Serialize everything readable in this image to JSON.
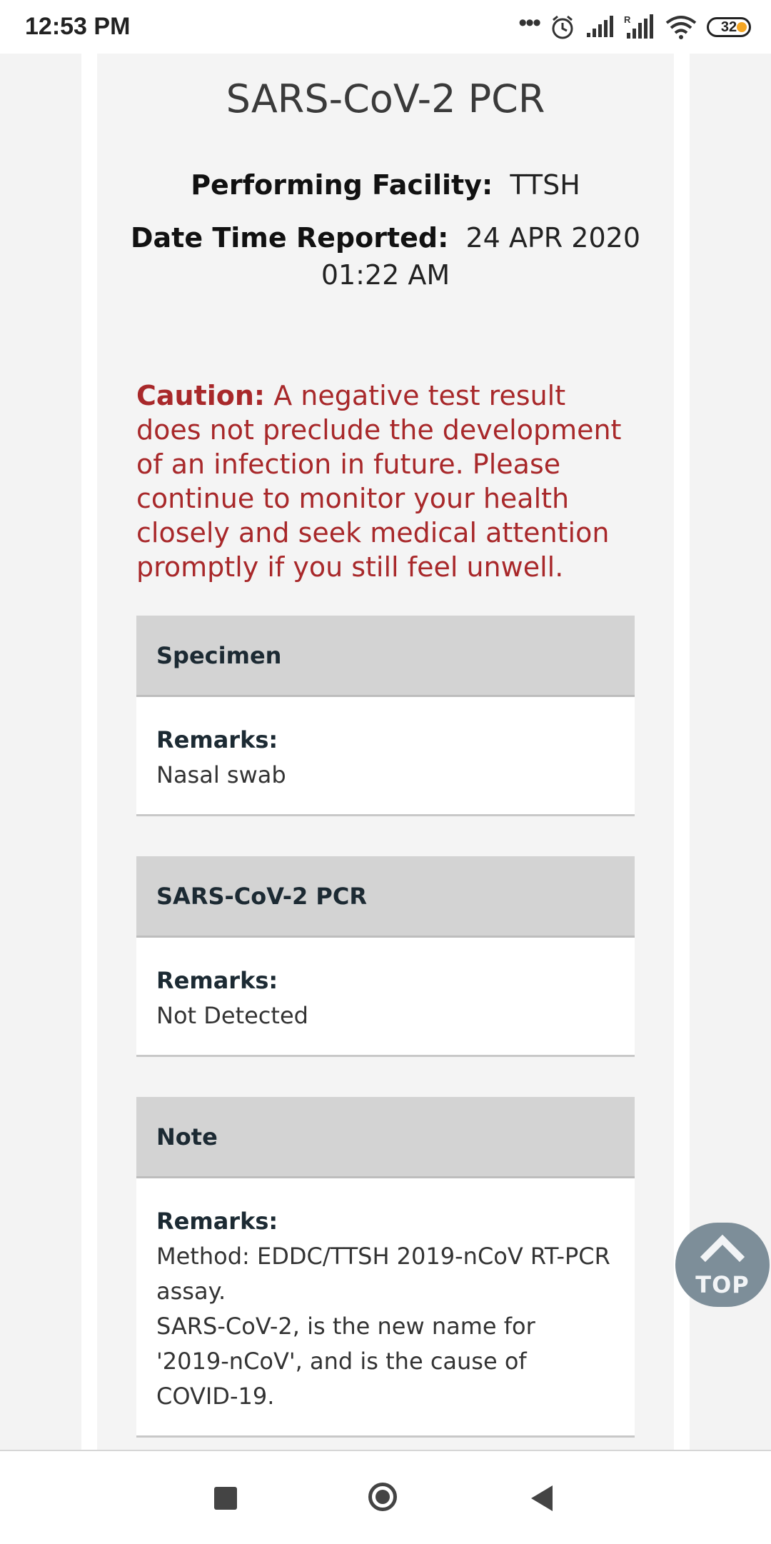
{
  "status_bar": {
    "time": "12:53 PM",
    "battery": "32"
  },
  "report": {
    "title": "SARS-CoV-2 PCR",
    "facility_label": "Performing Facility:",
    "facility_value": "TTSH",
    "reported_label": "Date Time Reported:",
    "reported_date": "24 APR 2020",
    "reported_time": "01:22 AM",
    "caution_label": "Caution:",
    "caution_text": "A negative test result does not preclude the development of an infection in future. Please continue to monitor your health closely and seek medical attention promptly if you still feel unwell."
  },
  "sections": [
    {
      "header": "Specimen",
      "remarks_label": "Remarks:",
      "remarks": "Nasal swab"
    },
    {
      "header": "SARS-CoV-2 PCR",
      "remarks_label": "Remarks:",
      "remarks": "Not Detected"
    },
    {
      "header": "Note",
      "remarks_label": "Remarks:",
      "remarks": "Method: EDDC/TTSH 2019-nCoV RT-PCR assay.\nSARS-CoV-2, is the new name for '2019-nCoV', and is the cause of COVID-19."
    }
  ],
  "top_button": {
    "label": "TOP"
  },
  "colors": {
    "caution": "#a8282a",
    "section_header_bg": "#d3d3d3",
    "top_button_bg": "#7d8e99"
  }
}
